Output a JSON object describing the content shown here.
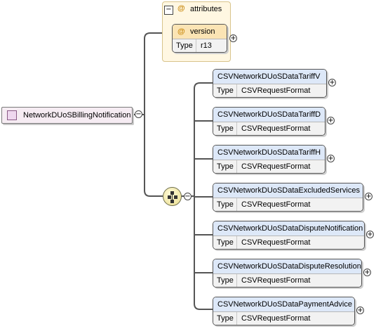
{
  "root": {
    "name": "NetworkDUoSBillingNotification"
  },
  "attributes_group": {
    "label": "attributes",
    "at_symbol": "@",
    "attribute": {
      "name": "version",
      "type_label": "Type",
      "type_value": "r13"
    }
  },
  "toggles": {
    "expanded": "−",
    "collapsed": "+"
  },
  "children": [
    {
      "name": "CSVNetworkDUoSDataTariffV",
      "type_label": "Type",
      "type_value": "CSVRequestFormat"
    },
    {
      "name": "CSVNetworkDUoSDataTariffD",
      "type_label": "Type",
      "type_value": "CSVRequestFormat"
    },
    {
      "name": "CSVNetworkDUoSDataTariffH",
      "type_label": "Type",
      "type_value": "CSVRequestFormat"
    },
    {
      "name": "CSVNetworkDUoSDataExcludedServices",
      "type_label": "Type",
      "type_value": "CSVRequestFormat"
    },
    {
      "name": "CSVNetworkDUoSDataDisputeNotification",
      "type_label": "Type",
      "type_value": "CSVRequestFormat"
    },
    {
      "name": "CSVNetworkDUoSDataDisputeResolution",
      "type_label": "Type",
      "type_value": "CSVRequestFormat"
    },
    {
      "name": "CSVNetworkDUoSDataPaymentAdvice",
      "type_label": "Type",
      "type_value": "CSVRequestFormat"
    }
  ],
  "colors": {
    "element_header": "#dde8f8",
    "attribute_header": "#fbe4b4",
    "root_fill": "#f6ecf3",
    "connector": "#555555"
  }
}
